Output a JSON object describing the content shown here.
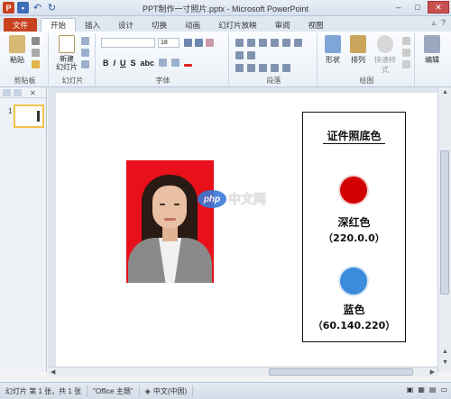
{
  "window": {
    "title": "PPT制作一寸照片.pptx - Microsoft PowerPoint",
    "app_icon": "powerpoint-icon",
    "quick_access": [
      "save-icon",
      "undo-icon",
      "redo-icon"
    ]
  },
  "tabs": [
    {
      "label": "文件",
      "type": "file"
    },
    {
      "label": "开始",
      "type": "active"
    },
    {
      "label": "插入",
      "type": "normal"
    },
    {
      "label": "设计",
      "type": "normal"
    },
    {
      "label": "切换",
      "type": "normal"
    },
    {
      "label": "动画",
      "type": "normal"
    },
    {
      "label": "幻灯片放映",
      "type": "normal"
    },
    {
      "label": "审阅",
      "type": "normal"
    },
    {
      "label": "视图",
      "type": "normal"
    }
  ],
  "ribbon": {
    "clipboard": {
      "paste_label": "粘贴",
      "group_label": "剪贴板"
    },
    "slides": {
      "new_slide_label": "新建\n幻灯片",
      "group_label": "幻灯片"
    },
    "font": {
      "group_label": "字体",
      "size_value": "18"
    },
    "paragraph": {
      "group_label": "段落"
    },
    "drawing": {
      "shape_label": "形状",
      "arrange_label": "排列",
      "quick_style_label": "快速样式",
      "group_label": "绘图"
    },
    "editing": {
      "label": "编辑"
    }
  },
  "slide_panel": {
    "slide_number": "1"
  },
  "slide": {
    "watermark_oval": "php",
    "watermark_text": "中文网",
    "info_title": "证件照底色",
    "colors": [
      {
        "name": "深红色",
        "value": "（220.0.0）",
        "hex": "#d20000"
      },
      {
        "name": "蓝色",
        "value": "（60.140.220）",
        "hex": "#3c8cdc"
      }
    ]
  },
  "status": {
    "slide_info": "幻灯片 第 1 张，共 1 张",
    "theme": "\"Office 主题\"",
    "language": "中文(中国)"
  }
}
